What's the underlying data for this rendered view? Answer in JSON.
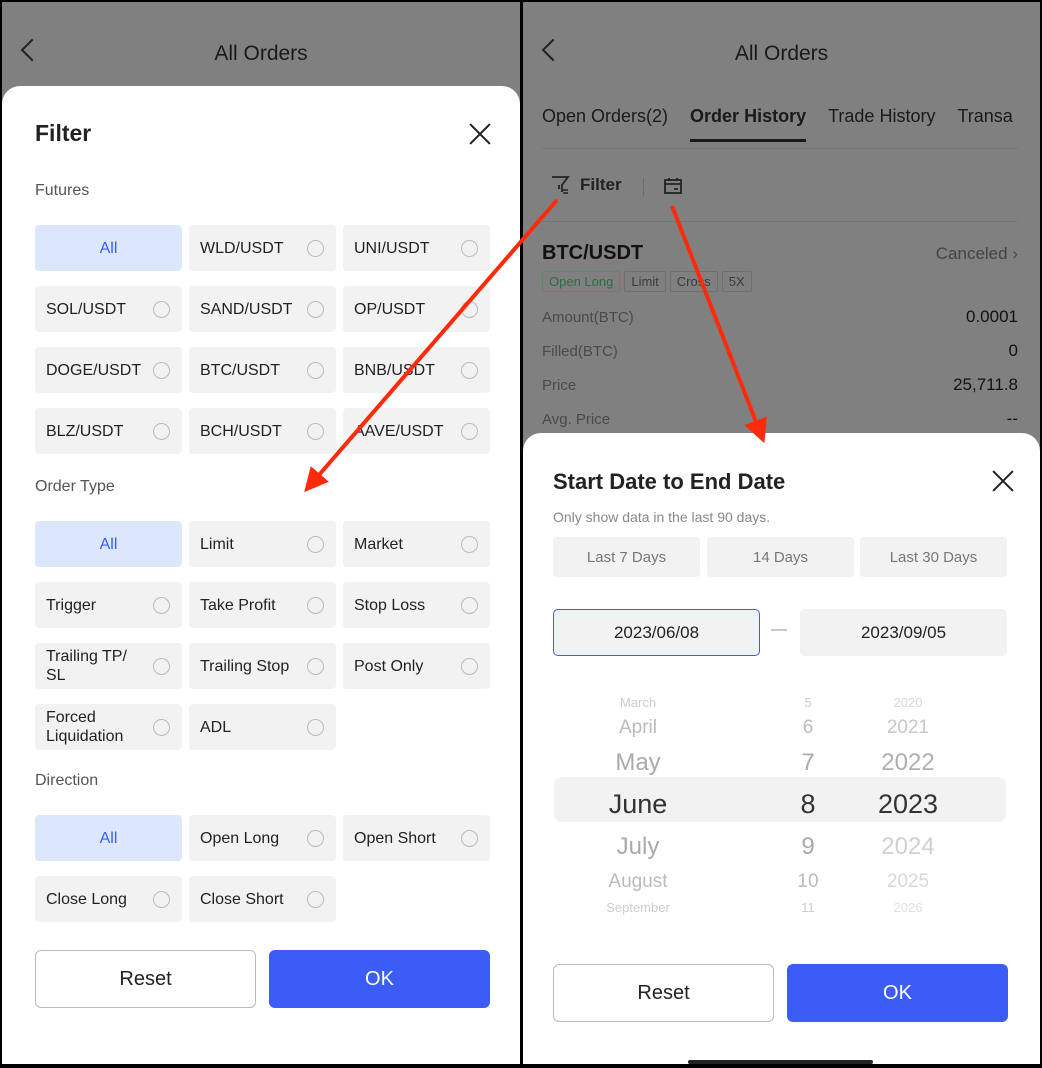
{
  "left": {
    "header": {
      "title": "All Orders"
    },
    "filter": {
      "title": "Filter",
      "sections": [
        {
          "label": "Futures",
          "items": [
            "All",
            "WLD/USDT",
            "UNI/USDT",
            "SOL/USDT",
            "SAND/USDT",
            "OP/USDT",
            "DOGE/USDT",
            "BTC/USDT",
            "BNB/USDT",
            "BLZ/USDT",
            "BCH/USDT",
            "AAVE/USDT"
          ]
        },
        {
          "label": "Order Type",
          "items": [
            "All",
            "Limit",
            "Market",
            "Trigger",
            "Take Profit",
            "Stop Loss",
            "Trailing TP/ SL",
            "Trailing Stop",
            "Post Only",
            "Forced Liquidation",
            "ADL"
          ]
        },
        {
          "label": "Direction",
          "items": [
            "All",
            "Open Long",
            "Open Short",
            "Close Long",
            "Close Short"
          ]
        }
      ],
      "reset": "Reset",
      "ok": "OK"
    }
  },
  "right": {
    "header": {
      "title": "All Orders"
    },
    "tabs": [
      "Open Orders(2)",
      "Order History",
      "Trade History",
      "Transa"
    ],
    "toolbar": {
      "filter": "Filter"
    },
    "order": {
      "pair": "BTC/USDT",
      "status": "Canceled",
      "tags": [
        "Open Long",
        "Limit",
        "Cross",
        "5X"
      ],
      "rows": [
        {
          "k": "Amount(BTC)",
          "v": "0.0001"
        },
        {
          "k": "Filled(BTC)",
          "v": "0"
        },
        {
          "k": "Price",
          "v": "25,711.8"
        },
        {
          "k": "Avg. Price",
          "v": "--"
        }
      ]
    },
    "dates": {
      "title": "Start Date to End Date",
      "note": "Only show data in the last 90 days.",
      "presets": [
        "Last 7 Days",
        "14 Days",
        "Last 30 Days"
      ],
      "start": "2023/06/08",
      "sep": "—",
      "end": "2023/09/05",
      "months": [
        "March",
        "April",
        "May",
        "June",
        "July",
        "August",
        "September"
      ],
      "days": [
        "5",
        "6",
        "7",
        "8",
        "9",
        "10",
        "11"
      ],
      "years": [
        "2020",
        "2021",
        "2022",
        "2023",
        "2024",
        "2025",
        "2026"
      ],
      "reset": "Reset",
      "ok": "OK"
    }
  },
  "colors": {
    "accent": "#3b5cf5",
    "selected_bg": "#dce7fd",
    "annotation_arrow": "#ff2a0a"
  }
}
